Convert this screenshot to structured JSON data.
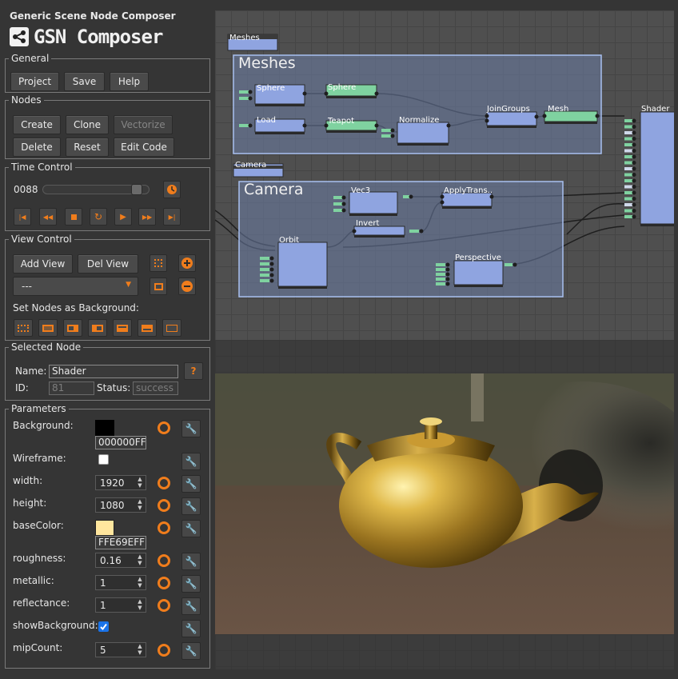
{
  "app": {
    "subtitle": "Generic Scene Node Composer",
    "title": "GSN Composer"
  },
  "general": {
    "legend": "General",
    "project": "Project",
    "save": "Save",
    "help": "Help"
  },
  "nodes": {
    "legend": "Nodes",
    "create": "Create",
    "clone": "Clone",
    "vectorize": "Vectorize",
    "delete": "Delete",
    "reset": "Reset",
    "edit_code": "Edit Code"
  },
  "time": {
    "legend": "Time Control",
    "frame": "0088",
    "slider_fraction": 0.92
  },
  "view": {
    "legend": "View Control",
    "add_view": "Add View",
    "del_view": "Del View",
    "select_value": "---",
    "set_bg_label": "Set Nodes as Background:"
  },
  "selected": {
    "legend": "Selected Node",
    "name_label": "Name:",
    "name_value": "Shader",
    "help": "?",
    "id_label": "ID:",
    "id_value": "81",
    "status_label": "Status:",
    "status_value": "success"
  },
  "params": {
    "legend": "Parameters",
    "background_label": "Background:",
    "background_value": "000000FF",
    "background_color": "#000000",
    "wireframe_label": "Wireframe:",
    "wireframe_checked": false,
    "width_label": "width:",
    "width_value": "1920",
    "height_label": "height:",
    "height_value": "1080",
    "basecolor_label": "baseColor:",
    "basecolor_value": "FFE69EFF",
    "basecolor_color": "#FFE69E",
    "roughness_label": "roughness:",
    "roughness_value": "0.16",
    "metallic_label": "metallic:",
    "metallic_value": "1",
    "reflectance_label": "reflectance:",
    "reflectance_value": "1",
    "showbg_label": "showBackground:",
    "showbg_checked": true,
    "mipcount_label": "mipCount:",
    "mipcount_value": "5"
  },
  "graph": {
    "groups": {
      "meshes": "Meshes",
      "camera": "Camera"
    },
    "tags": {
      "meshes": "Meshes",
      "camera": "Camera"
    },
    "nodes": {
      "sphere1": "Sphere",
      "sphere2": "Sphere",
      "load": "Load",
      "teapot": "Teapot",
      "normalize": "Normalize",
      "joingroups": "JoinGroups",
      "mesh": "Mesh",
      "shader": "Shader",
      "vec3": "Vec3",
      "applytrans": "ApplyTrans..",
      "invert": "Invert",
      "orbit": "Orbit",
      "perspective": "Perspective"
    }
  },
  "colors": {
    "accent": "#f07d1c",
    "node_body": "#8fa4e0",
    "node_green": "#7fd2a0",
    "group_fill": "#6e7fa8"
  }
}
